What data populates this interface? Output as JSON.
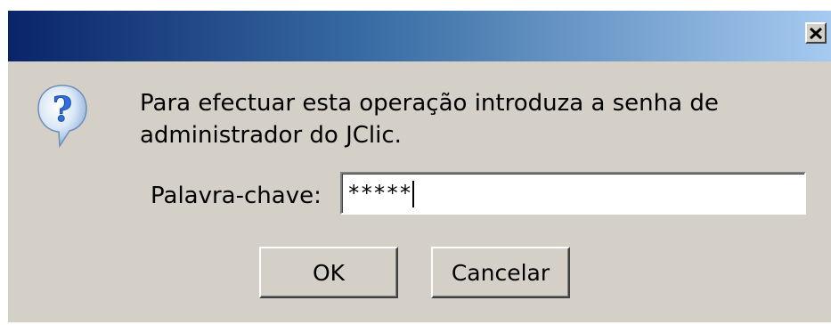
{
  "dialog": {
    "title": "",
    "message": "Para efectuar esta operação introduza a senha de administrador do JClic.",
    "icon": "question-icon",
    "password": {
      "label": "Palavra-chave:",
      "value": "*****"
    },
    "buttons": {
      "ok_label": "OK",
      "cancel_label": "Cancelar"
    },
    "close_glyph": "close-icon"
  },
  "colors": {
    "dialog_background": "#d4d0c8",
    "titlebar_start": "#0a246a",
    "titlebar_end": "#a6caf0",
    "icon_blue": "#2f6ee0"
  }
}
